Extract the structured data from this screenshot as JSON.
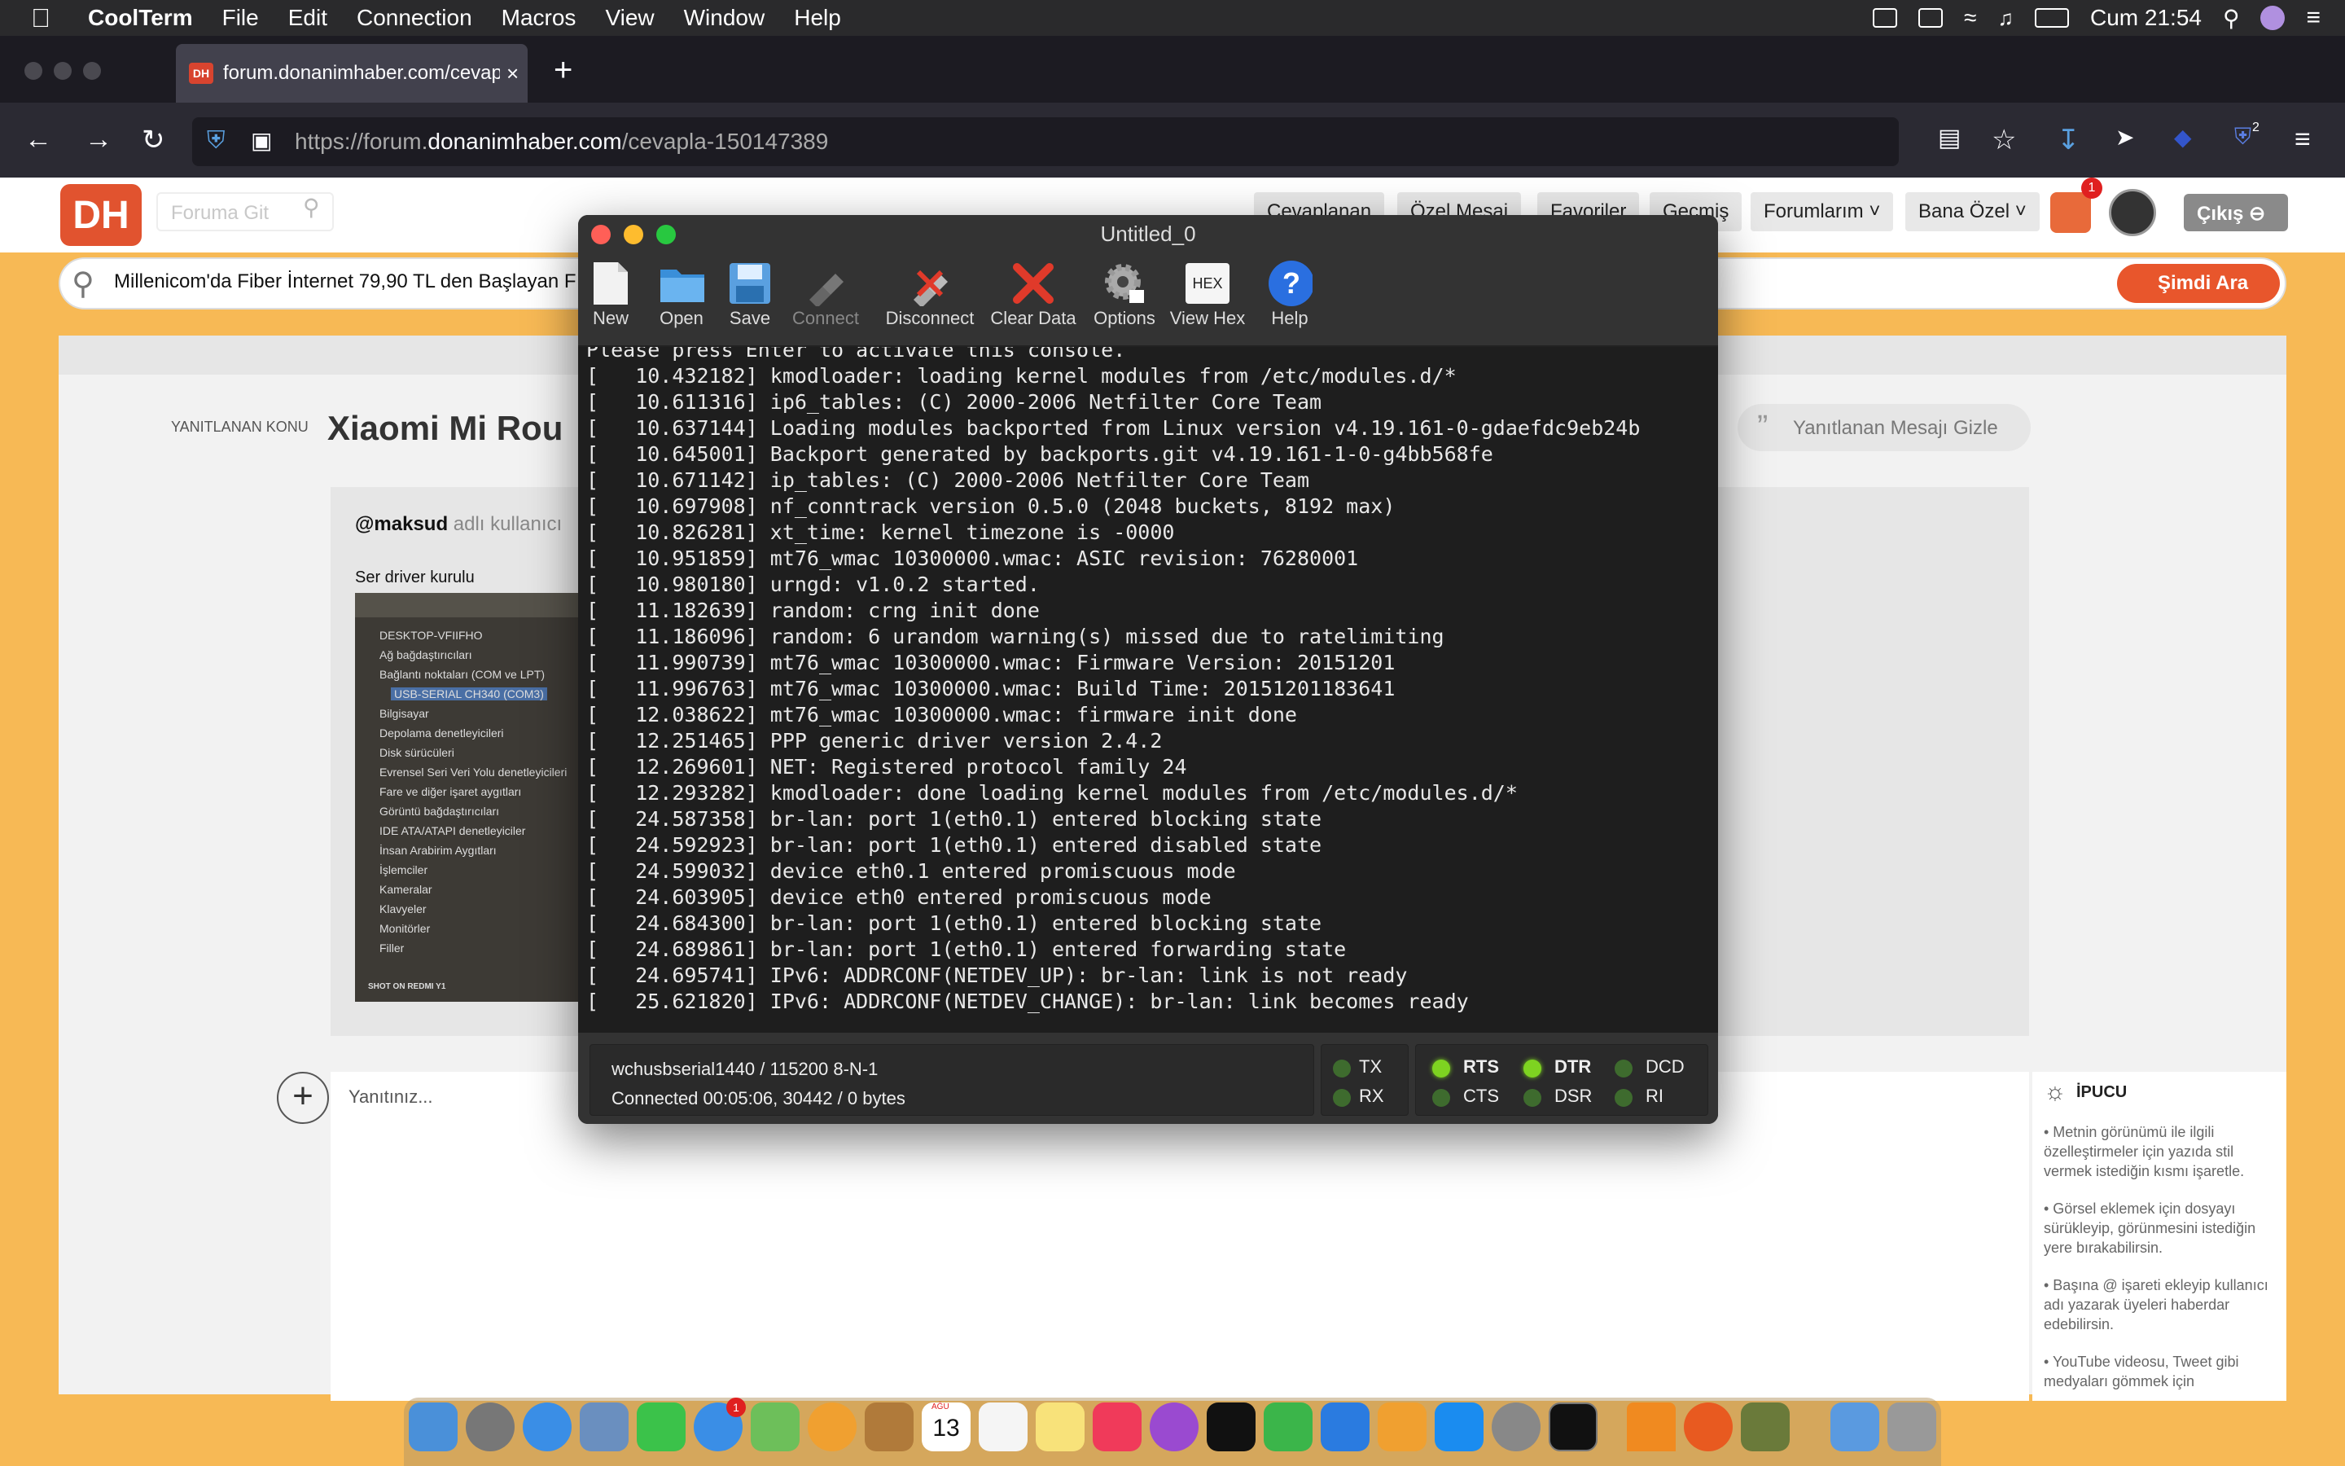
{
  "menubar": {
    "app_name": "CoolTerm",
    "items": [
      "File",
      "Edit",
      "Connection",
      "Macros",
      "View",
      "Window",
      "Help"
    ],
    "clock": "Cum 21:54"
  },
  "browser": {
    "tab_title": "forum.donanimhaber.com/cevapla",
    "tab_favicon": "DH",
    "url_prefix": "https://forum.",
    "url_domain": "donanimhaber.com",
    "url_path": "/cevapla-150147389",
    "download_badge": "2"
  },
  "site": {
    "logo": "DH",
    "goto_placeholder": "Foruma Git",
    "nav": [
      "Cevaplanan",
      "Özel Mesaj",
      "Favoriler",
      "Geçmiş"
    ],
    "forumlarim": "Forumlarım",
    "bana_ozel": "Bana Özel",
    "notification_count": "1",
    "logout": "Çıkış",
    "search_text": "Millenicom'da Fiber İnternet 79,90 TL den Başlayan F",
    "search_button": "Şimdi Ara",
    "reply_label": "YANITLANAN KONU",
    "thread_title": "Xiaomi Mi Rou",
    "hide_quote": "Yanıtlanan Mesajı Gizle",
    "quote_author": "@maksud",
    "quote_author_suffix": "adlı kullanıcı",
    "quote_text": "Ser driver kurulu",
    "device_lines": [
      "DESKTOP-VFIIFHO",
      "Ağ bağdaştırıcıları",
      "Bağlantı noktaları (COM ve LPT)",
      "USB-SERIAL CH340 (COM3)",
      "Bilgisayar",
      "Depolama denetleyicileri",
      "Disk sürücüleri",
      "Evrensel Seri Veri Yolu denetleyicileri",
      "Fare ve diğer işaret aygıtları",
      "Görüntü bağdaştırıcıları",
      "IDE ATA/ATAPI denetleyiciler",
      "İnsan Arabirim Aygıtları",
      "İşlemciler",
      "Kameralar",
      "Klavyeler",
      "Monitörler",
      "Filler"
    ],
    "photo_caption": "SHOT ON REDMI Y1",
    "reply_placeholder": "Yanıtınız...",
    "tip_title": "İPUCU",
    "tips": [
      "• Metnin görünümü ile ilgili özelleştirmeler için yazıda stil vermek istediğin kısmı işaretle.",
      "• Görsel eklemek için dosyayı sürükleyip, görünmesini istediğin yere bırakabilirsin.",
      "• Başına @ işareti ekleyip kullanıcı adı yazarak üyeleri haberdar edebilirsin.",
      "• YouTube videosu, Tweet gibi medyaları gömmek için"
    ]
  },
  "coolterm": {
    "title": "Untitled_0",
    "toolbar": [
      {
        "label": "New",
        "icon": "new-document-icon",
        "enabled": true
      },
      {
        "label": "Open",
        "icon": "open-folder-icon",
        "enabled": true
      },
      {
        "label": "Save",
        "icon": "save-disk-icon",
        "enabled": true
      },
      {
        "label": "Connect",
        "icon": "connect-plug-icon",
        "enabled": false
      },
      {
        "label": "Disconnect",
        "icon": "disconnect-plug-icon",
        "enabled": true
      },
      {
        "label": "Clear Data",
        "icon": "clear-x-icon",
        "enabled": true
      },
      {
        "label": "Options",
        "icon": "gear-icon",
        "enabled": true
      },
      {
        "label": "View Hex",
        "icon": "hex-icon",
        "enabled": true
      },
      {
        "label": "Help",
        "icon": "help-icon",
        "enabled": true
      }
    ],
    "hex_glyph": "HEX",
    "console_lines": [
      "Please press Enter to activate this console.",
      "[   10.432182] kmodloader: loading kernel modules from /etc/modules.d/*",
      "[   10.611316] ip6_tables: (C) 2000-2006 Netfilter Core Team",
      "[   10.637144] Loading modules backported from Linux version v4.19.161-0-gdaefdc9eb24b",
      "[   10.645001] Backport generated by backports.git v4.19.161-1-0-g4bb568fe",
      "[   10.671142] ip_tables: (C) 2000-2006 Netfilter Core Team",
      "[   10.697908] nf_conntrack version 0.5.0 (2048 buckets, 8192 max)",
      "[   10.826281] xt_time: kernel timezone is -0000",
      "[   10.951859] mt76_wmac 10300000.wmac: ASIC revision: 76280001",
      "[   10.980180] urngd: v1.0.2 started.",
      "[   11.182639] random: crng init done",
      "[   11.186096] random: 6 urandom warning(s) missed due to ratelimiting",
      "[   11.990739] mt76_wmac 10300000.wmac: Firmware Version: 20151201",
      "[   11.996763] mt76_wmac 10300000.wmac: Build Time: 20151201183641",
      "[   12.038622] mt76_wmac 10300000.wmac: firmware init done",
      "[   12.251465] PPP generic driver version 2.4.2",
      "[   12.269601] NET: Registered protocol family 24",
      "[   12.293282] kmodloader: done loading kernel modules from /etc/modules.d/*",
      "[   24.587358] br-lan: port 1(eth0.1) entered blocking state",
      "[   24.592923] br-lan: port 1(eth0.1) entered disabled state",
      "[   24.599032] device eth0.1 entered promiscuous mode",
      "[   24.603905] device eth0 entered promiscuous mode",
      "[   24.684300] br-lan: port 1(eth0.1) entered blocking state",
      "[   24.689861] br-lan: port 1(eth0.1) entered forwarding state",
      "[   24.695741] IPv6: ADDRCONF(NETDEV_UP): br-lan: link is not ready",
      "[   25.621820] IPv6: ADDRCONF(NETDEV_CHANGE): br-lan: link becomes ready"
    ],
    "port": "wchusbserial1440 / 115200 8-N-1",
    "connection": "Connected 00:05:06, 30442 / 0 bytes",
    "leds": {
      "tx": {
        "label": "TX",
        "on": false
      },
      "rx": {
        "label": "RX",
        "on": false
      },
      "rts": {
        "label": "RTS",
        "on": true
      },
      "cts": {
        "label": "CTS",
        "on": false
      },
      "dtr": {
        "label": "DTR",
        "on": true
      },
      "dsr": {
        "label": "DSR",
        "on": false
      },
      "dcd": {
        "label": "DCD",
        "on": false
      },
      "ri": {
        "label": "RI",
        "on": false
      }
    }
  },
  "dock": {
    "calendar_month": "AĞU",
    "calendar_day": "13",
    "badge": "1"
  }
}
